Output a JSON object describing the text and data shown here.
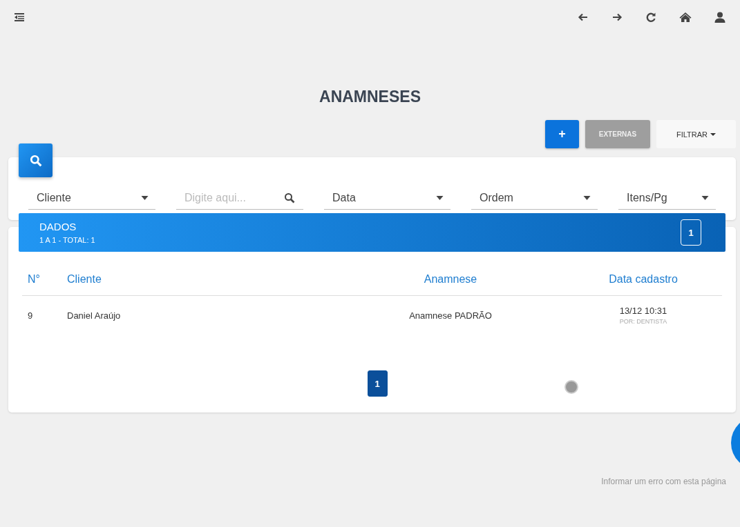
{
  "title": "ANAMNESES",
  "actions": [
    {
      "kind": "add",
      "label": "+"
    },
    {
      "kind": "secondary",
      "label": "EXTERNAS"
    },
    {
      "kind": "dropdown",
      "label": "FILTRAR"
    }
  ],
  "filters": [
    {
      "kind": "select",
      "label": "Cliente"
    },
    {
      "kind": "search",
      "placeholder": "Digite aqui..."
    },
    {
      "kind": "select",
      "label": "Data"
    },
    {
      "kind": "select",
      "label": "Ordem"
    },
    {
      "kind": "select",
      "label": "Itens/Pg"
    }
  ],
  "data_header": {
    "title": "DADOS",
    "subtitle": "1 A 1 - TOTAL: 1",
    "page_badge": "1"
  },
  "table": {
    "columns": [
      {
        "label": "N°"
      },
      {
        "label": "Cliente"
      },
      {
        "label": "Anamnese"
      },
      {
        "label": "Data cadastro"
      }
    ],
    "rows": [
      {
        "number": "9",
        "client": "Daniel Araújo",
        "anamnese": "Anamnese PADRÃO",
        "date": "13/12 10:31",
        "by": "POR: DENTISTA"
      }
    ]
  },
  "pagination": [
    {
      "label": "1",
      "selected": true
    }
  ],
  "footer_link": "Informar um erro com esta página"
}
